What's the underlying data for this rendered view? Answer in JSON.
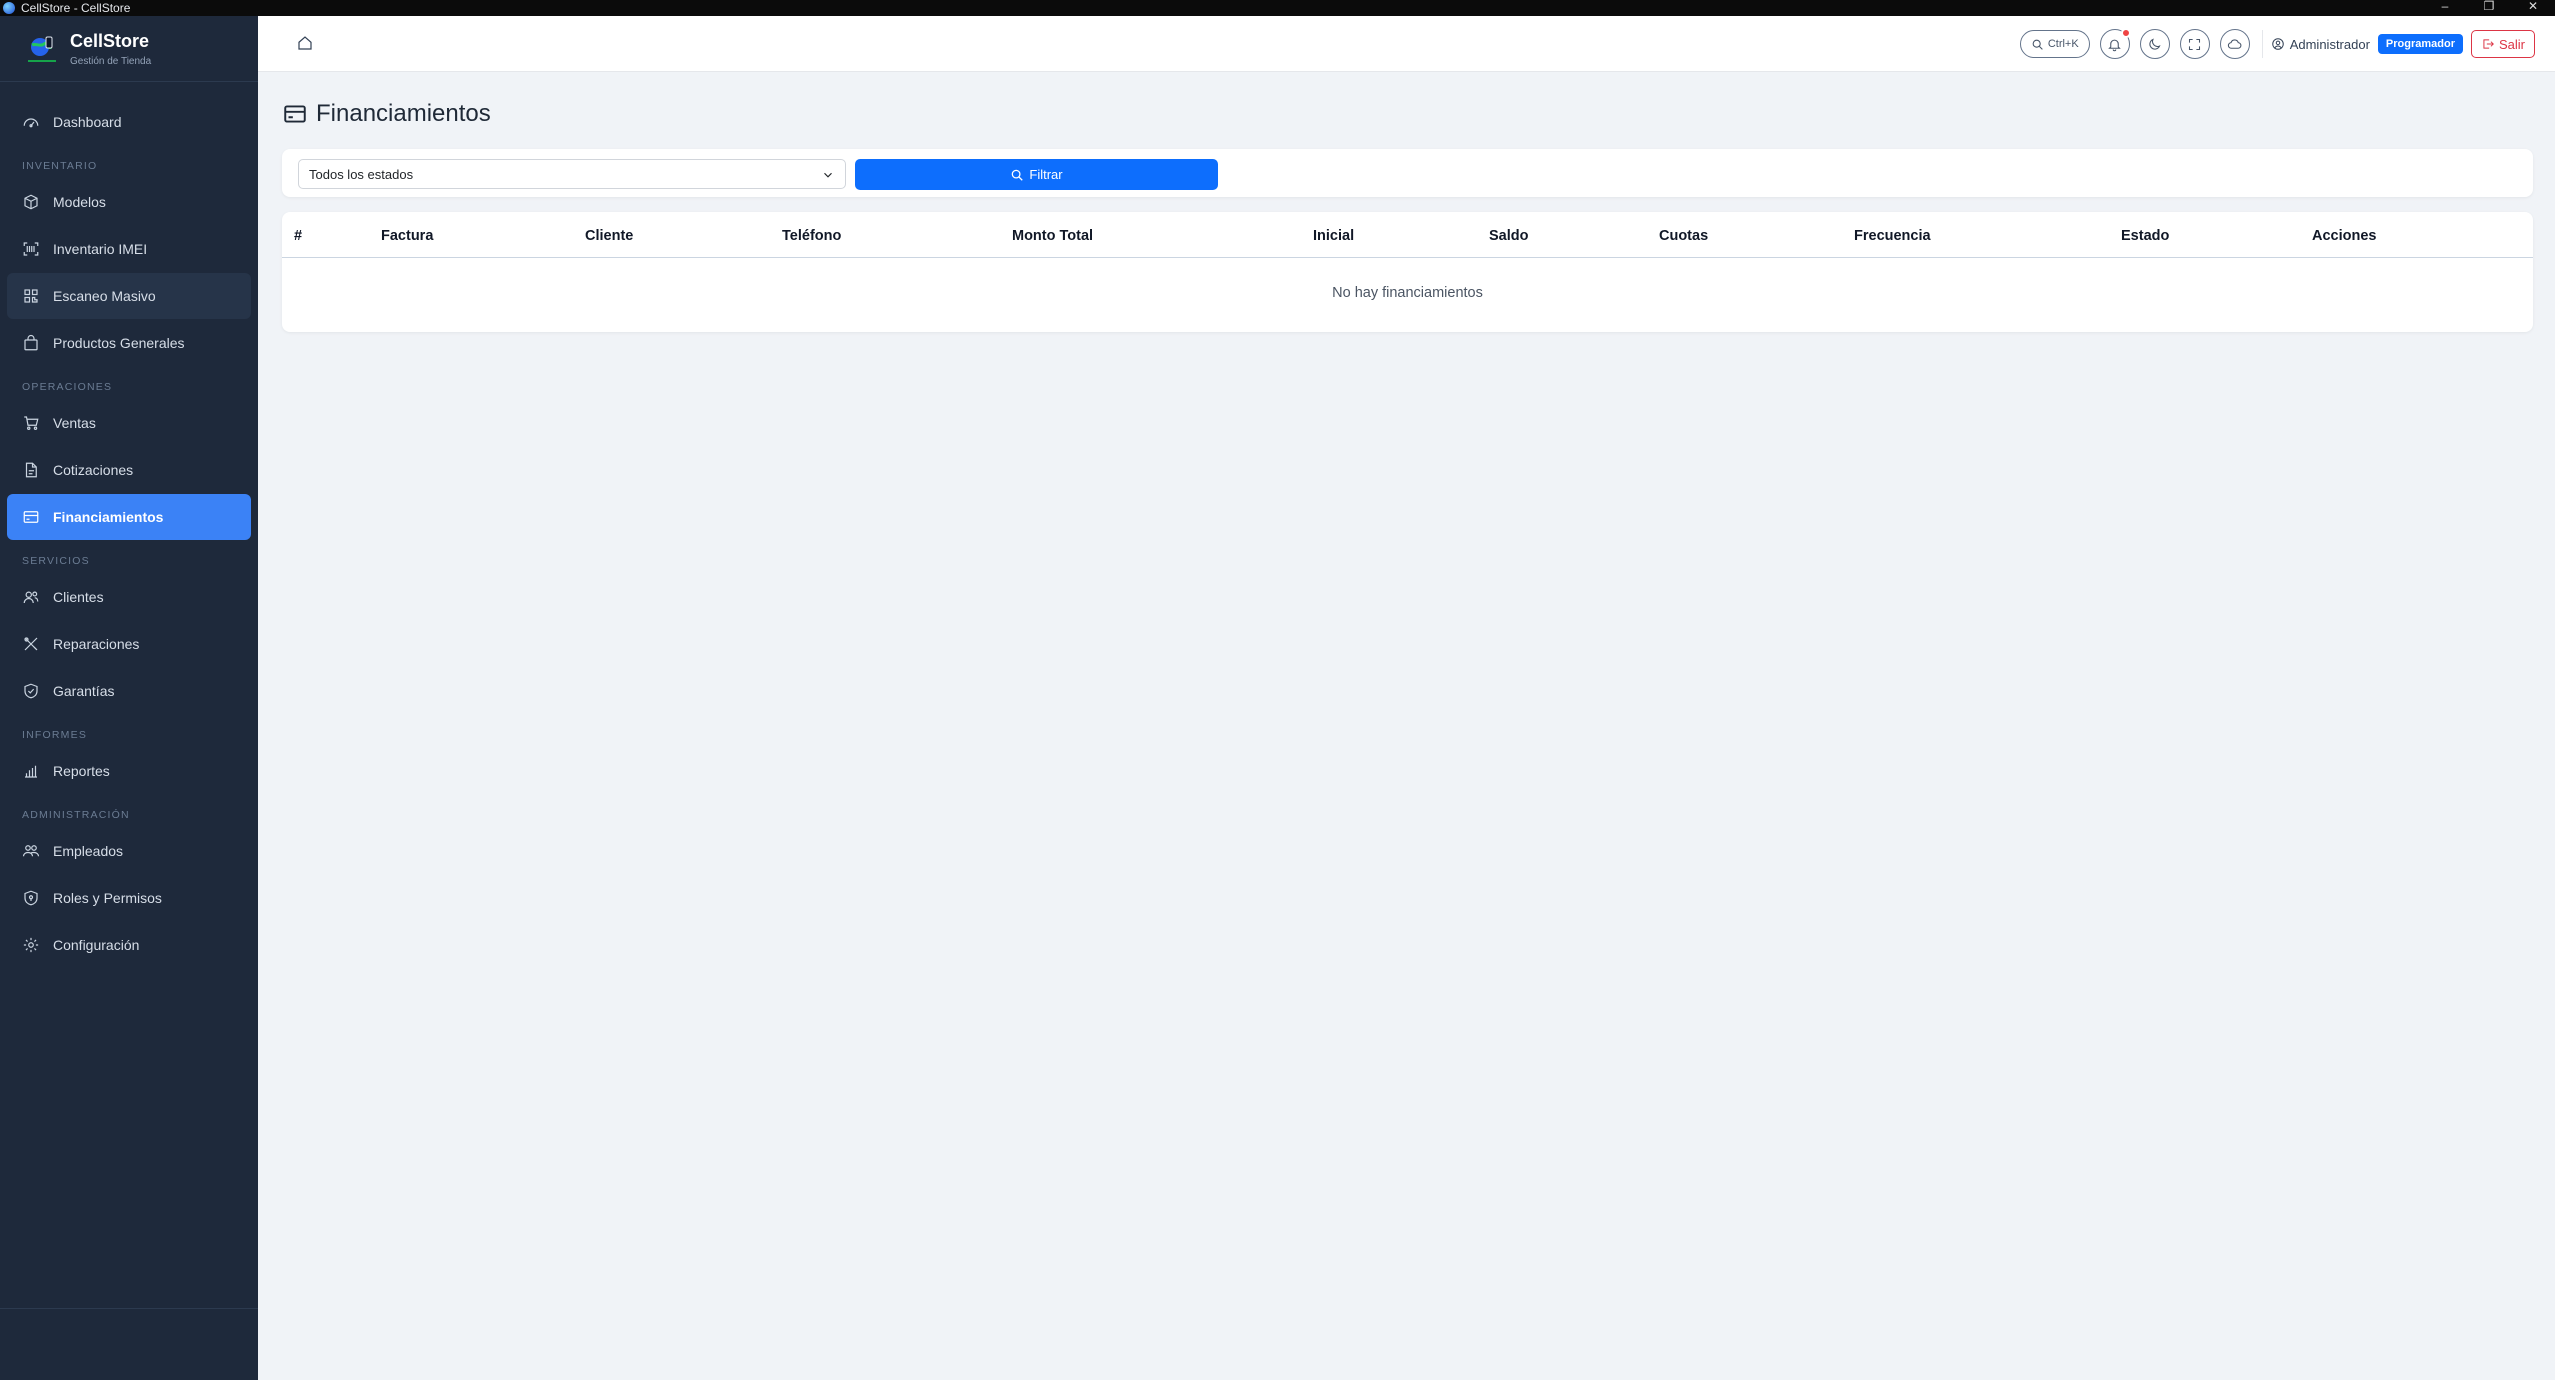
{
  "window": {
    "title": "CellStore - CellStore",
    "controls": [
      "–",
      "❐",
      "✕"
    ]
  },
  "brand": {
    "name": "CellStore",
    "subtitle": "Gestión de Tienda"
  },
  "sidebar": {
    "sections": [
      {
        "label": "",
        "items": [
          {
            "label": "Dashboard",
            "icon": "dashboard-icon"
          }
        ]
      },
      {
        "label": "INVENTARIO",
        "items": [
          {
            "label": "Modelos",
            "icon": "box-icon"
          },
          {
            "label": "Inventario IMEI",
            "icon": "scan-icon"
          },
          {
            "label": "Escaneo Masivo",
            "icon": "qr-scan-icon"
          },
          {
            "label": "Productos Generales",
            "icon": "bag-icon"
          }
        ]
      },
      {
        "label": "OPERACIONES",
        "items": [
          {
            "label": "Ventas",
            "icon": "cart-icon"
          },
          {
            "label": "Cotizaciones",
            "icon": "document-icon"
          },
          {
            "label": "Financiamientos",
            "icon": "credit-card-icon"
          }
        ]
      },
      {
        "label": "SERVICIOS",
        "items": [
          {
            "label": "Clientes",
            "icon": "users-icon"
          },
          {
            "label": "Reparaciones",
            "icon": "tools-icon"
          },
          {
            "label": "Garantías",
            "icon": "shield-check-icon"
          }
        ]
      },
      {
        "label": "INFORMES",
        "items": [
          {
            "label": "Reportes",
            "icon": "bar-chart-icon"
          }
        ]
      },
      {
        "label": "ADMINISTRACIÓN",
        "items": [
          {
            "label": "Empleados",
            "icon": "people-icon"
          },
          {
            "label": "Roles y Permisos",
            "icon": "shield-lock-icon"
          },
          {
            "label": "Configuración",
            "icon": "gear-icon"
          }
        ]
      }
    ],
    "active": "Financiamientos",
    "hovered": "Escaneo Masivo"
  },
  "topbar": {
    "search_shortcut": "Ctrl+K",
    "user_name": "Administrador",
    "role": "Programador",
    "logout": "Salir"
  },
  "page": {
    "title": "Financiamientos",
    "filter": {
      "status_selected": "Todos los estados",
      "button": "Filtrar"
    },
    "table": {
      "columns": [
        "#",
        "Factura",
        "Cliente",
        "Teléfono",
        "Monto Total",
        "Inicial",
        "Saldo",
        "Cuotas",
        "Frecuencia",
        "Estado",
        "Acciones"
      ],
      "empty_message": "No hay financiamientos"
    }
  },
  "colors": {
    "sidebar_bg": "#1e293b",
    "active_item": "#3b82f6",
    "primary": "#0d6efd",
    "danger": "#dc3545",
    "page_bg": "#f0f3f7"
  }
}
